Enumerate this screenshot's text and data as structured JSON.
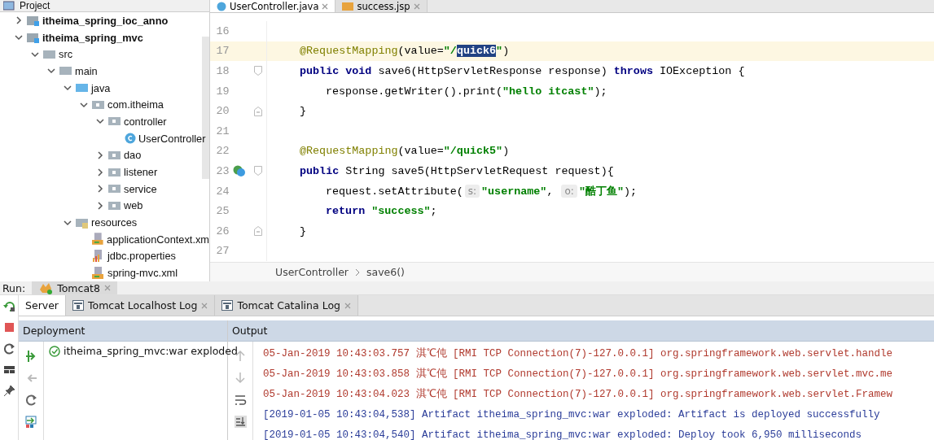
{
  "project_panel": {
    "title": "Project",
    "tree": [
      {
        "label": "itheima_spring_ioc_anno",
        "kind": "module",
        "expanded": false
      },
      {
        "label": "itheima_spring_mvc",
        "kind": "module",
        "expanded": true,
        "children": [
          {
            "label": "src",
            "kind": "folder",
            "expanded": true,
            "children": [
              {
                "label": "main",
                "kind": "folder",
                "expanded": true,
                "children": [
                  {
                    "label": "java",
                    "kind": "source-folder",
                    "expanded": true,
                    "children": [
                      {
                        "label": "com.itheima",
                        "kind": "package",
                        "expanded": true,
                        "children": [
                          {
                            "label": "controller",
                            "kind": "package",
                            "expanded": true,
                            "children": [
                              {
                                "label": "UserController",
                                "kind": "class"
                              }
                            ]
                          },
                          {
                            "label": "dao",
                            "kind": "package",
                            "expanded": false
                          },
                          {
                            "label": "listener",
                            "kind": "package",
                            "expanded": false
                          },
                          {
                            "label": "service",
                            "kind": "package",
                            "expanded": false
                          },
                          {
                            "label": "web",
                            "kind": "package",
                            "expanded": false
                          }
                        ]
                      }
                    ]
                  },
                  {
                    "label": "resources",
                    "kind": "resource-folder",
                    "expanded": true,
                    "children": [
                      {
                        "label": "applicationContext.xm",
                        "kind": "xml"
                      },
                      {
                        "label": "jdbc.properties",
                        "kind": "properties"
                      },
                      {
                        "label": "spring-mvc.xml",
                        "kind": "xml"
                      }
                    ]
                  }
                ]
              }
            ]
          }
        ]
      }
    ]
  },
  "editor": {
    "tabs": [
      {
        "label": "UserController.java",
        "kind": "java",
        "selected": true
      },
      {
        "label": "success.jsp",
        "kind": "jsp",
        "selected": false
      }
    ],
    "lines": [
      {
        "number": "16",
        "kind": "blank",
        "current": false,
        "gutter_icon": false,
        "fold_start": false,
        "fold_end": false
      },
      {
        "number": "17",
        "kind": "member",
        "current": true,
        "gutter_icon": false,
        "fold_start": false,
        "fold_end": false,
        "tokens": [
          {
            "kind": "annotation",
            "text": "@RequestMapping"
          },
          {
            "kind": "plain",
            "text": "(value="
          },
          {
            "kind": "string",
            "text": "\"/"
          },
          {
            "kind": "string",
            "text": "quick6",
            "selected": true
          },
          {
            "kind": "string",
            "text": "\""
          },
          {
            "kind": "plain",
            "text": ")"
          }
        ]
      },
      {
        "number": "18",
        "kind": "member",
        "current": false,
        "gutter_icon": false,
        "fold_start": true,
        "fold_end": false,
        "tokens": [
          {
            "kind": "keyword",
            "text": "public void "
          },
          {
            "kind": "plain",
            "text": "save6(HttpServletResponse response) "
          },
          {
            "kind": "keyword",
            "text": "throws "
          },
          {
            "kind": "plain",
            "text": "IOException {"
          }
        ]
      },
      {
        "number": "19",
        "kind": "body",
        "current": false,
        "gutter_icon": false,
        "fold_start": false,
        "fold_end": false,
        "tokens": [
          {
            "kind": "plain",
            "text": "response.getWriter().print("
          },
          {
            "kind": "string",
            "text": "\"hello itcast\""
          },
          {
            "kind": "plain",
            "text": ");"
          }
        ]
      },
      {
        "number": "20",
        "kind": "member",
        "current": false,
        "gutter_icon": false,
        "fold_start": false,
        "fold_end": true,
        "tokens": [
          {
            "kind": "plain",
            "text": "}"
          }
        ]
      },
      {
        "number": "21",
        "kind": "blank",
        "current": false,
        "gutter_icon": false,
        "fold_start": false,
        "fold_end": false
      },
      {
        "number": "22",
        "kind": "member",
        "current": false,
        "gutter_icon": false,
        "fold_start": false,
        "fold_end": false,
        "tokens": [
          {
            "kind": "annotation",
            "text": "@RequestMapping"
          },
          {
            "kind": "plain",
            "text": "(value="
          },
          {
            "kind": "string",
            "text": "\"/quick5\""
          },
          {
            "kind": "plain",
            "text": ")"
          }
        ]
      },
      {
        "number": "23",
        "kind": "member",
        "current": false,
        "gutter_icon": true,
        "fold_start": true,
        "fold_end": false,
        "tokens": [
          {
            "kind": "keyword",
            "text": "public "
          },
          {
            "kind": "plain",
            "text": "String save5(HttpServletRequest request){"
          }
        ]
      },
      {
        "number": "24",
        "kind": "body",
        "current": false,
        "gutter_icon": false,
        "fold_start": false,
        "fold_end": false,
        "tokens": [
          {
            "kind": "plain",
            "text": "request.setAttribute("
          },
          {
            "kind": "hint",
            "text": "s:"
          },
          {
            "kind": "string",
            "text": "\"username\""
          },
          {
            "kind": "plain",
            "text": ", "
          },
          {
            "kind": "hint",
            "text": "o:"
          },
          {
            "kind": "string",
            "text": "\"酷丁鱼\""
          },
          {
            "kind": "plain",
            "text": ");"
          }
        ]
      },
      {
        "number": "25",
        "kind": "body",
        "current": false,
        "gutter_icon": false,
        "fold_start": false,
        "fold_end": false,
        "tokens": [
          {
            "kind": "keyword",
            "text": "return "
          },
          {
            "kind": "string",
            "text": "\"success\""
          },
          {
            "kind": "plain",
            "text": ";"
          }
        ]
      },
      {
        "number": "26",
        "kind": "member",
        "current": false,
        "gutter_icon": false,
        "fold_start": false,
        "fold_end": true,
        "tokens": [
          {
            "kind": "plain",
            "text": "}"
          }
        ]
      },
      {
        "number": "27",
        "kind": "blank",
        "current": false,
        "gutter_icon": false,
        "fold_start": false,
        "fold_end": false
      }
    ],
    "breadcrumbs": [
      "UserController",
      "save6()"
    ]
  },
  "run_panel": {
    "label": "Run:",
    "config_tab": {
      "label": "Tomcat8"
    },
    "tabs": [
      {
        "label": "Server",
        "closable": false,
        "selected": true
      },
      {
        "label": "Tomcat Localhost Log",
        "closable": true,
        "selected": false
      },
      {
        "label": "Tomcat Catalina Log",
        "closable": true,
        "selected": false
      }
    ],
    "deployment": {
      "title": "Deployment",
      "items": [
        {
          "label": "itheima_spring_mvc:war exploded",
          "deployed": true
        }
      ]
    },
    "output": {
      "title": "Output",
      "lines": [
        {
          "kind": "stderr",
          "text": "05-Jan-2019 10:43:03.757 淇℃伅 [RMI TCP Connection(7)-127.0.0.1] org.springframework.web.servlet.handle"
        },
        {
          "kind": "stderr",
          "text": "05-Jan-2019 10:43:03.858 淇℃伅 [RMI TCP Connection(7)-127.0.0.1] org.springframework.web.servlet.mvc.me"
        },
        {
          "kind": "stderr",
          "text": "05-Jan-2019 10:43:04.023 淇℃伅 [RMI TCP Connection(7)-127.0.0.1] org.springframework.web.servlet.Framew"
        },
        {
          "kind": "info",
          "text": "[2019-01-05 10:43:04,538] Artifact itheima_spring_mvc:war exploded: Artifact is deployed successfully"
        },
        {
          "kind": "info",
          "text": "[2019-01-05 10:43:04,540] Artifact itheima_spring_mvc:war exploded: Deploy took 6,950 milliseconds"
        }
      ]
    }
  }
}
